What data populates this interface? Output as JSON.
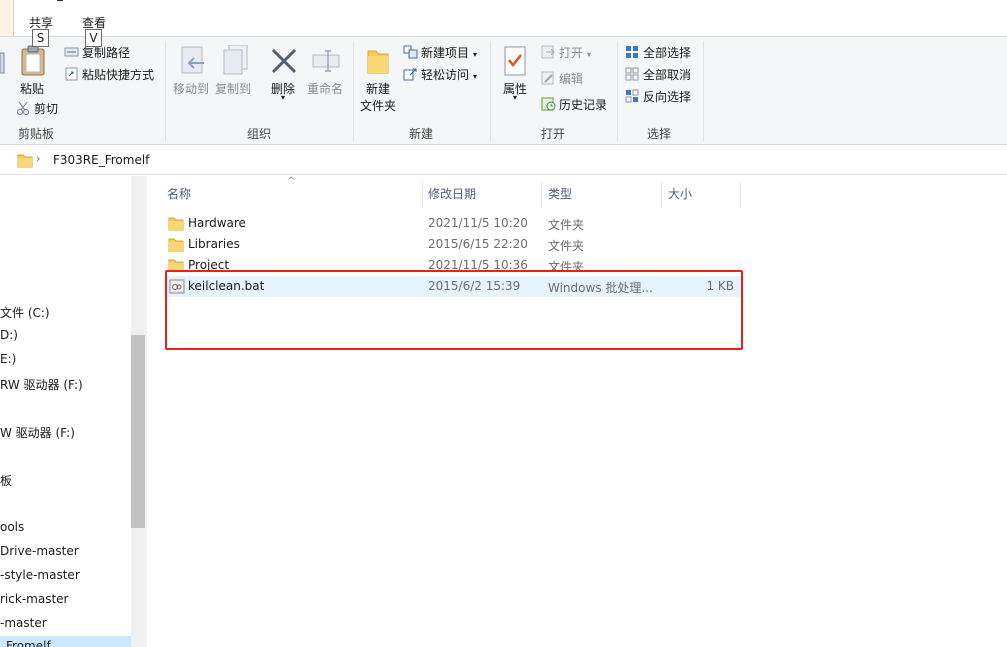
{
  "tabs": {
    "share": "共享",
    "share_keytip": "S",
    "view": "查看",
    "view_keytip": "V"
  },
  "ribbon": {
    "clipboard": {
      "group_label": "剪贴板",
      "paste": "粘贴",
      "copy_path": "复制路径",
      "paste_shortcut": "粘贴快捷方式",
      "cut": "剪切"
    },
    "organize": {
      "group_label": "组织",
      "move_to": "移动到",
      "copy_to": "复制到",
      "delete": "删除",
      "rename": "重命名"
    },
    "new": {
      "group_label": "新建",
      "new_folder_line1": "新建",
      "new_folder_line2": "文件夹",
      "new_item": "新建项目",
      "easy_access": "轻松访问"
    },
    "open": {
      "group_label": "打开",
      "properties": "属性",
      "open": "打开",
      "edit": "编辑",
      "history": "历史记录"
    },
    "select": {
      "group_label": "选择",
      "select_all": "全部选择",
      "select_none": "全部取消",
      "invert": "反向选择"
    }
  },
  "address": {
    "path": "F303RE_Fromelf"
  },
  "nav": {
    "items": [
      "文件 (C:)",
      "D:)",
      "E:)",
      "RW 驱动器 (F:)",
      "W 驱动器 (F:)",
      "板",
      "ools",
      "Drive-master",
      "-style-master",
      "rick-master",
      "-master",
      "_Fromelf"
    ]
  },
  "columns": {
    "name": "名称",
    "modified": "修改日期",
    "type": "类型",
    "size": "大小"
  },
  "files": [
    {
      "name": "Hardware",
      "modified": "2021/11/5 10:20",
      "type": "文件夹",
      "size": "",
      "kind": "folder"
    },
    {
      "name": "Libraries",
      "modified": "2015/6/15 22:20",
      "type": "文件夹",
      "size": "",
      "kind": "folder"
    },
    {
      "name": "Project",
      "modified": "2021/11/5 10:36",
      "type": "文件夹",
      "size": "",
      "kind": "folder"
    },
    {
      "name": "keilclean.bat",
      "modified": "2015/6/2 15:39",
      "type": "Windows 批处理...",
      "size": "1 KB",
      "kind": "bat"
    }
  ],
  "colors": {
    "highlight_box": "#e8221b",
    "row_hover": "#e5f3ff",
    "folder_yellow": "#f8d775"
  }
}
